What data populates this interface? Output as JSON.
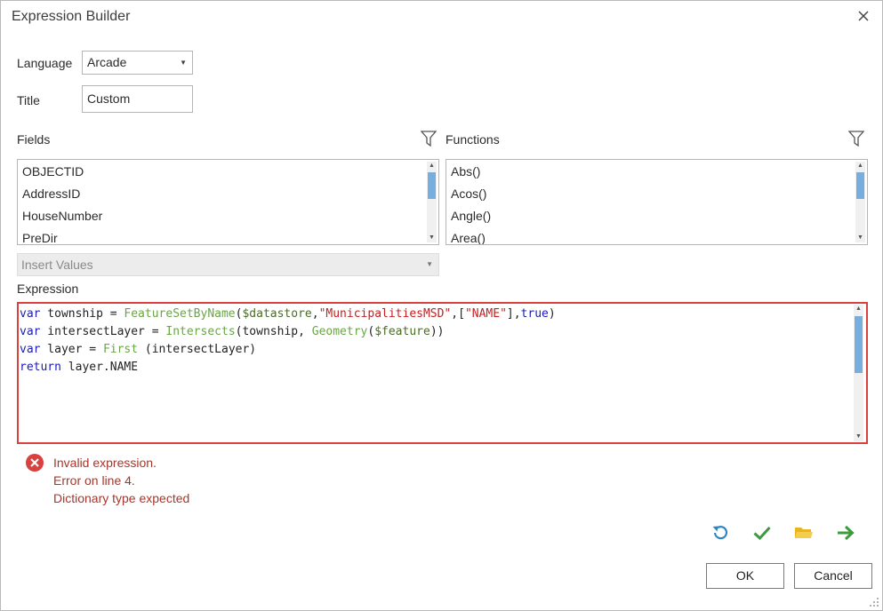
{
  "dialog": {
    "title": "Expression Builder",
    "close_icon": "close-icon"
  },
  "language": {
    "label": "Language",
    "value": "Arcade"
  },
  "title_field": {
    "label": "Title",
    "value": "Custom"
  },
  "fields": {
    "label": "Fields",
    "items": [
      "OBJECTID",
      "AddressID",
      "HouseNumber",
      "PreDir"
    ]
  },
  "functions": {
    "label": "Functions",
    "items": [
      "Abs()",
      "Acos()",
      "Angle()",
      "Area()"
    ]
  },
  "insert_values": {
    "placeholder": "Insert Values"
  },
  "expression": {
    "label": "Expression",
    "lines": [
      "var township = FeatureSetByName($datastore,\"MunicipalitiesMSD\",[\"NAME\"],true)",
      "var intersectLayer = Intersects(township, Geometry($feature))",
      "var layer = First (intersectLayer)",
      "return layer.NAME"
    ]
  },
  "error": {
    "lines": [
      "Invalid expression.",
      "Error on line 4.",
      "Dictionary type expected"
    ],
    "color": "#a8352a"
  },
  "toolbar": {
    "icons": [
      "undo-icon",
      "check-icon",
      "folder-icon",
      "arrow-right-icon"
    ]
  },
  "buttons": {
    "ok": "OK",
    "cancel": "Cancel"
  },
  "colors": {
    "error_border": "#d9413f",
    "scroll_thumb": "#77aede",
    "keyword": "#1a1ab8",
    "function": "#6aa546",
    "string": "#c51f1f"
  }
}
